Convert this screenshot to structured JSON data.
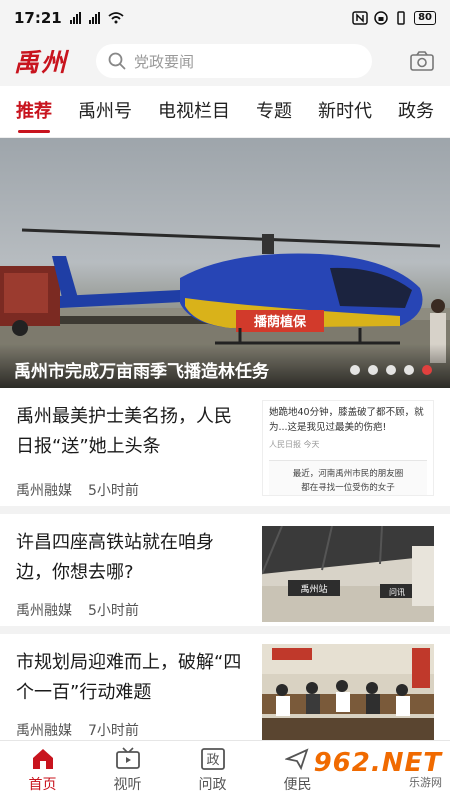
{
  "status_bar": {
    "time": "17:21",
    "signal_labels": [
      "4G",
      "4G"
    ],
    "battery": "80"
  },
  "header": {
    "logo": "禹州",
    "search_placeholder": "党政要闻",
    "camera_icon": "camera-icon"
  },
  "tabs": [
    {
      "label": "推荐",
      "active": true
    },
    {
      "label": "禹州号"
    },
    {
      "label": "电视栏目"
    },
    {
      "label": "专题"
    },
    {
      "label": "新时代"
    },
    {
      "label": "政务"
    }
  ],
  "banner": {
    "caption": "禹州市完成万亩雨季飞播造林任务",
    "helicopter_text": "播荫植保",
    "dots_count": 5,
    "active_dot": 5
  },
  "news": [
    {
      "title": "禹州最美护士美名扬，人民日报“送”她上头条",
      "source": "禹州融媒",
      "time": "5小时前",
      "thumb_line1": "她跪地40分钟，膝盖破了都不顾，就为...这是我见过最美的伤疤!",
      "thumb_source": "人民日报",
      "thumb_source_time": "今天",
      "thumb_line2": "最近，河南禹州市民的朋友圈",
      "thumb_line3": "都在寻找一位受伤的女子"
    },
    {
      "title": "许昌四座高铁站就在咱身边，你想去哪?",
      "source": "禹州融媒",
      "time": "5小时前",
      "thumb_sign1": "禹州站",
      "thumb_sign2": "问讯"
    },
    {
      "title": "市规划局迎难而上，破解“四个一百”行动难题",
      "source": "禹州融媒",
      "time": "7小时前"
    }
  ],
  "bottom_nav": [
    {
      "label": "首页",
      "icon": "home-icon",
      "active": true
    },
    {
      "label": "视听",
      "icon": "tv-icon"
    },
    {
      "label": "问政",
      "icon": "zheng-icon",
      "glyph": "政"
    },
    {
      "label": "便民",
      "icon": "service-icon"
    }
  ],
  "watermark": {
    "big": "962.NET",
    "small": "乐游网"
  },
  "colors": {
    "brand_red": "#c8141e",
    "text": "#1a1a1a",
    "meta": "#555555"
  }
}
